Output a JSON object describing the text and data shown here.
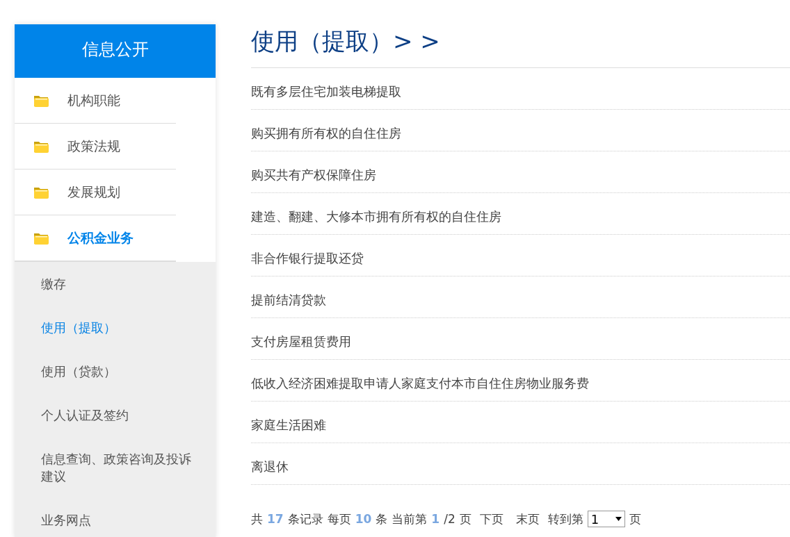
{
  "sidebar": {
    "title": "信息公开",
    "items": [
      {
        "label": "机构职能",
        "selected": false
      },
      {
        "label": "政策法规",
        "selected": false
      },
      {
        "label": "发展规划",
        "selected": false
      },
      {
        "label": "公积金业务",
        "selected": true
      }
    ],
    "subitems": [
      {
        "label": "缴存",
        "selected": false
      },
      {
        "label": "使用（提取）",
        "selected": true
      },
      {
        "label": "使用（贷款）",
        "selected": false
      },
      {
        "label": "个人认证及签约",
        "selected": false
      },
      {
        "label": "信息查询、政策咨询及投诉建议",
        "selected": false
      },
      {
        "label": "业务网点",
        "selected": false
      }
    ]
  },
  "content": {
    "title": "使用（提取）> >",
    "articles": [
      "既有多层住宅加装电梯提取",
      "购买拥有所有权的自住住房",
      "购买共有产权保障住房",
      "建造、翻建、大修本市拥有所有权的自住住房",
      "非合作银行提取还贷",
      "提前结清贷款",
      "支付房屋租赁费用",
      "低收入经济困难提取申请人家庭支付本市自住住房物业服务费",
      "家庭生活困难",
      "离退休"
    ],
    "pagination": [
      {
        "kind": "text",
        "text": "共"
      },
      {
        "kind": "number",
        "text": "17"
      },
      {
        "kind": "text",
        "text": "条记录"
      },
      {
        "kind": "text",
        "text": "每页"
      },
      {
        "kind": "number",
        "text": "10"
      },
      {
        "kind": "text",
        "text": "条"
      },
      {
        "kind": "text",
        "text": "当前第"
      },
      {
        "kind": "number",
        "text": "1"
      },
      {
        "kind": "text",
        "text": "/2"
      },
      {
        "kind": "text",
        "text": "页"
      },
      {
        "kind": "link",
        "text": "下页"
      },
      {
        "kind": "link",
        "text": "末页"
      },
      {
        "kind": "text",
        "text": "转到第"
      },
      {
        "kind": "select",
        "text": "1"
      },
      {
        "kind": "text",
        "text": "页"
      }
    ]
  }
}
